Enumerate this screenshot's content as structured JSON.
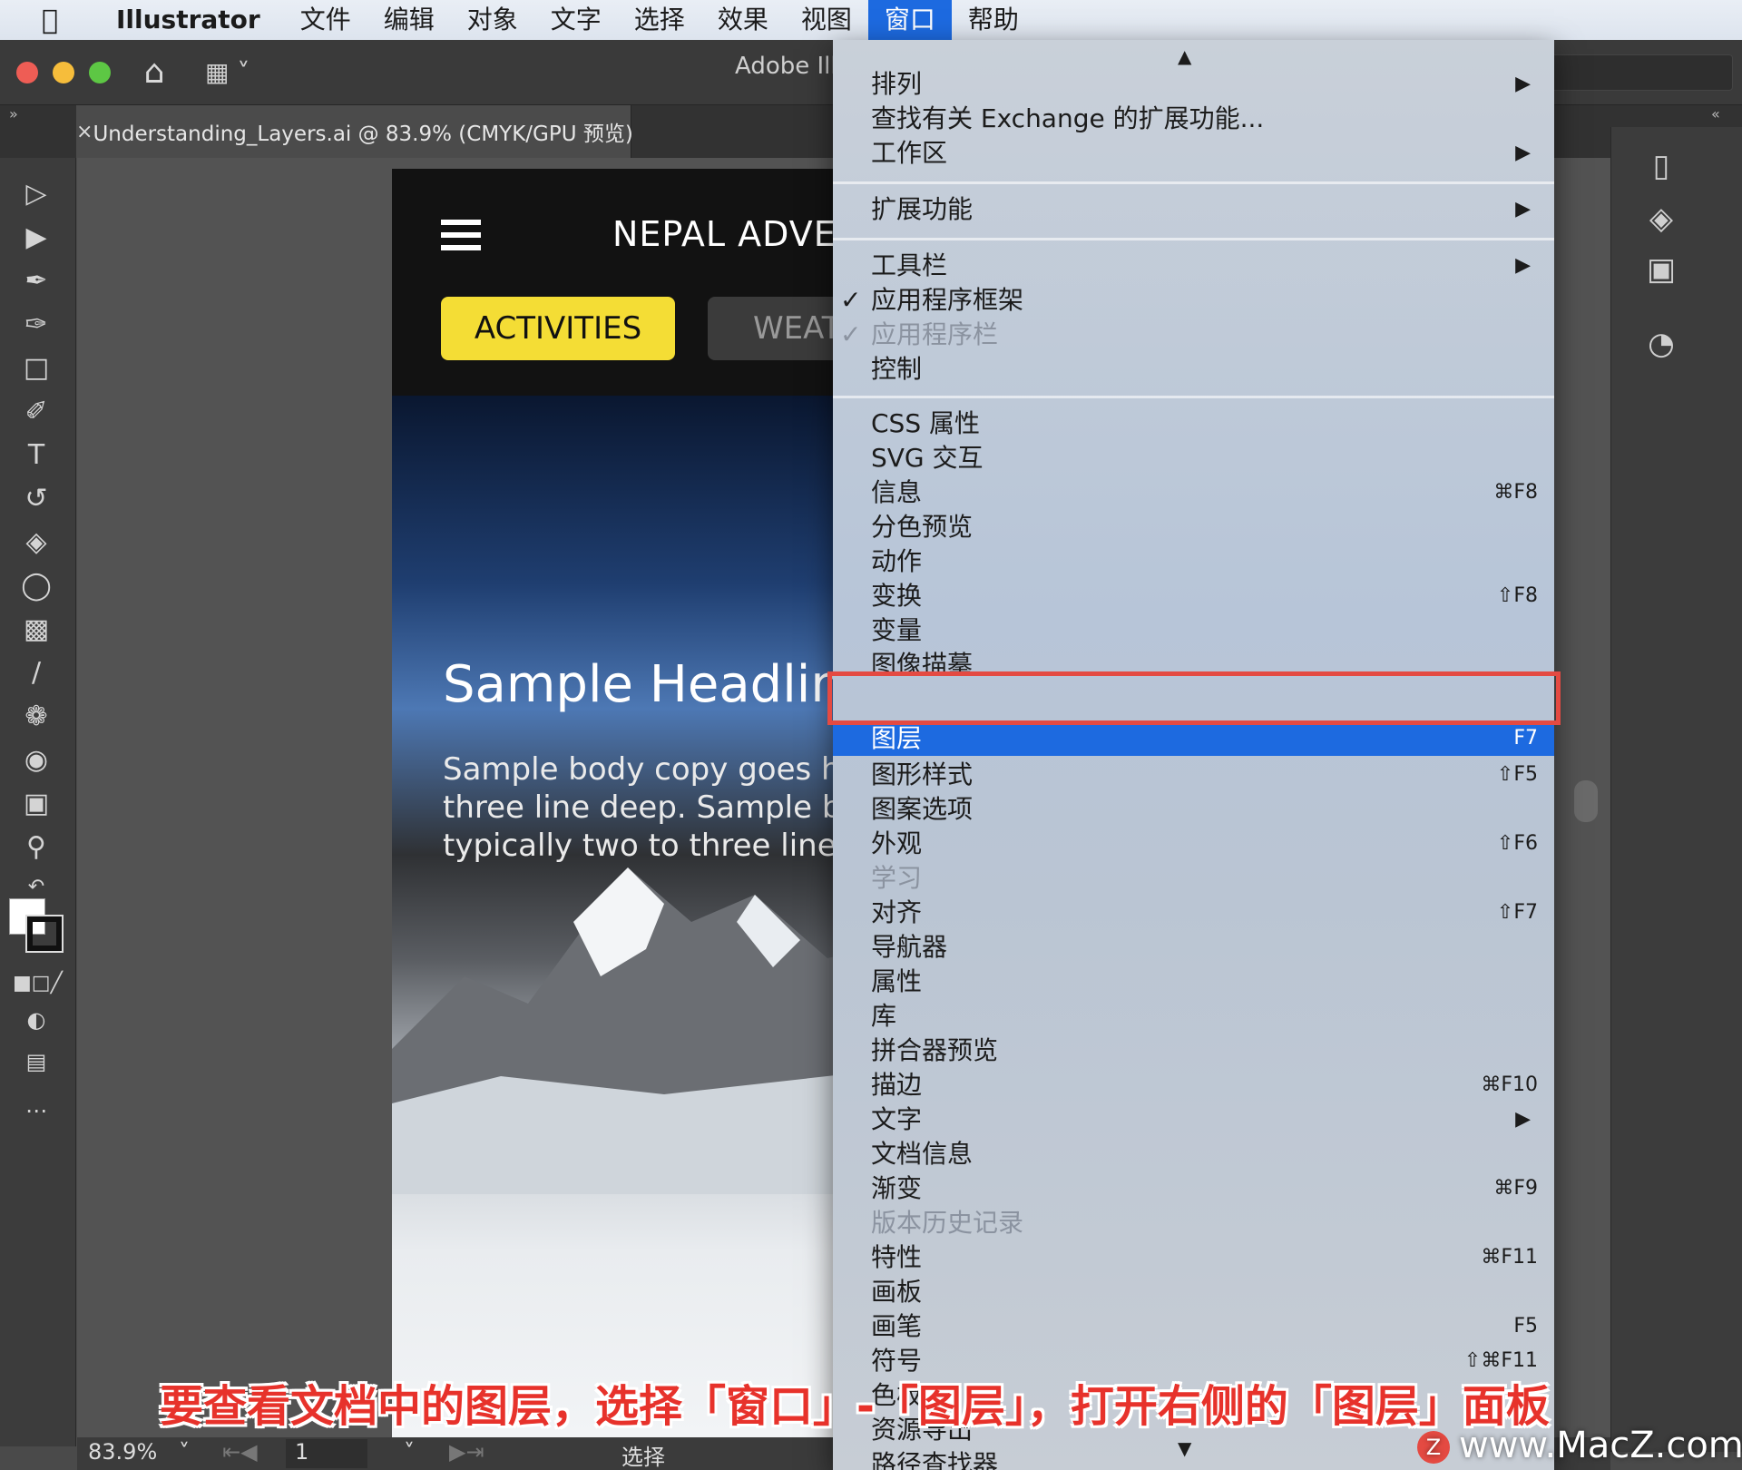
{
  "menubar": {
    "app": "Illustrator",
    "items": [
      "文件",
      "编辑",
      "对象",
      "文字",
      "选择",
      "效果",
      "视图",
      "窗口",
      "帮助"
    ],
    "active": "窗口"
  },
  "appbar": {
    "title": "Adobe Illustrator"
  },
  "tab": {
    "label": "Understanding_Layers.ai @ 83.9% (CMYK/GPU 预览)"
  },
  "artboard": {
    "brand": "NEPAL ADVENTURE",
    "btn_activities": "ACTIVITIES",
    "btn_weather": "WEATHER",
    "headline": "Sample Headline",
    "body": [
      "Sample body copy goes here",
      "three line deep. Sample body",
      "typically two to three line deep"
    ]
  },
  "statusbar": {
    "zoom": "83.9%",
    "page": "1",
    "tool": "选择"
  },
  "dropdown": {
    "sections": [
      [
        {
          "label": "排列",
          "submenu": true
        },
        {
          "label": "查找有关 Exchange 的扩展功能..."
        },
        {
          "label": "工作区",
          "submenu": true
        }
      ],
      [
        {
          "label": "扩展功能",
          "submenu": true
        }
      ],
      [
        {
          "label": "工具栏",
          "submenu": true
        },
        {
          "label": "应用程序框架",
          "checked": true
        },
        {
          "label": "应用程序栏",
          "checked": true,
          "disabled": true
        },
        {
          "label": "控制"
        }
      ],
      [
        {
          "label": "CSS 属性"
        },
        {
          "label": "SVG 交互"
        },
        {
          "label": "信息",
          "shortcut": "⌘F8"
        },
        {
          "label": "分色预览"
        },
        {
          "label": "动作"
        },
        {
          "label": "变换",
          "shortcut": "⇧F8"
        },
        {
          "label": "变量"
        },
        {
          "label": "图像描摹"
        },
        {
          "label": "图层",
          "shortcut": "F7",
          "highlighted": true
        },
        {
          "label": "图形样式",
          "shortcut": "⇧F5"
        },
        {
          "label": "图案选项"
        },
        {
          "label": "外观",
          "shortcut": "⇧F6"
        },
        {
          "label": "学习",
          "disabled": true
        },
        {
          "label": "对齐",
          "shortcut": "⇧F7"
        },
        {
          "label": "导航器"
        },
        {
          "label": "属性"
        },
        {
          "label": "库"
        },
        {
          "label": "拼合器预览"
        },
        {
          "label": "描边",
          "shortcut": "⌘F10"
        },
        {
          "label": "文字",
          "submenu": true
        },
        {
          "label": "文档信息"
        },
        {
          "label": "渐变",
          "shortcut": "⌘F9"
        },
        {
          "label": "版本历史记录",
          "disabled": true
        },
        {
          "label": "特性",
          "shortcut": "⌘F11"
        },
        {
          "label": "画板"
        },
        {
          "label": "画笔",
          "shortcut": "F5"
        },
        {
          "label": "符号",
          "shortcut": "⇧⌘F11"
        },
        {
          "label": "色板"
        },
        {
          "label": "资源导出"
        },
        {
          "label": "路径查找器"
        }
      ]
    ]
  },
  "caption": "要查看文档中的图层，选择「窗口」-「图层」，打开右侧的「图层」面板",
  "watermark": "www.MacZ.com",
  "colors": {
    "menu_highlight": "#1d6ae0",
    "annotation_red": "#e44a42",
    "button_yellow": "#f4dd35"
  }
}
